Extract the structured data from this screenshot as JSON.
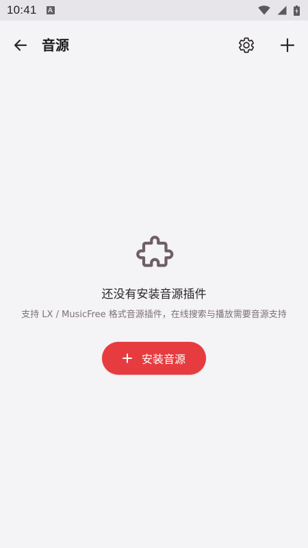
{
  "status_bar": {
    "time": "10:41",
    "notification_letter": "A",
    "icons": [
      "wifi-icon",
      "signal-icon",
      "battery-icon"
    ]
  },
  "app_bar": {
    "title": "音源",
    "back_icon": "arrow-left-icon",
    "settings_icon": "gear-icon",
    "add_icon": "plus-icon"
  },
  "empty_state": {
    "icon": "puzzle-piece-icon",
    "title": "还没有安装音源插件",
    "description": "支持 LX / MusicFree 格式音源插件，在线搜索与播放需要音源支持",
    "button_label": "安装音源",
    "button_icon": "plus-icon"
  },
  "colors": {
    "background": "#f4f3f6",
    "status_bar": "#e7e5e9",
    "accent": "#e63c3f",
    "icon": "#5b4d52",
    "secondary_text": "#7d7178"
  }
}
